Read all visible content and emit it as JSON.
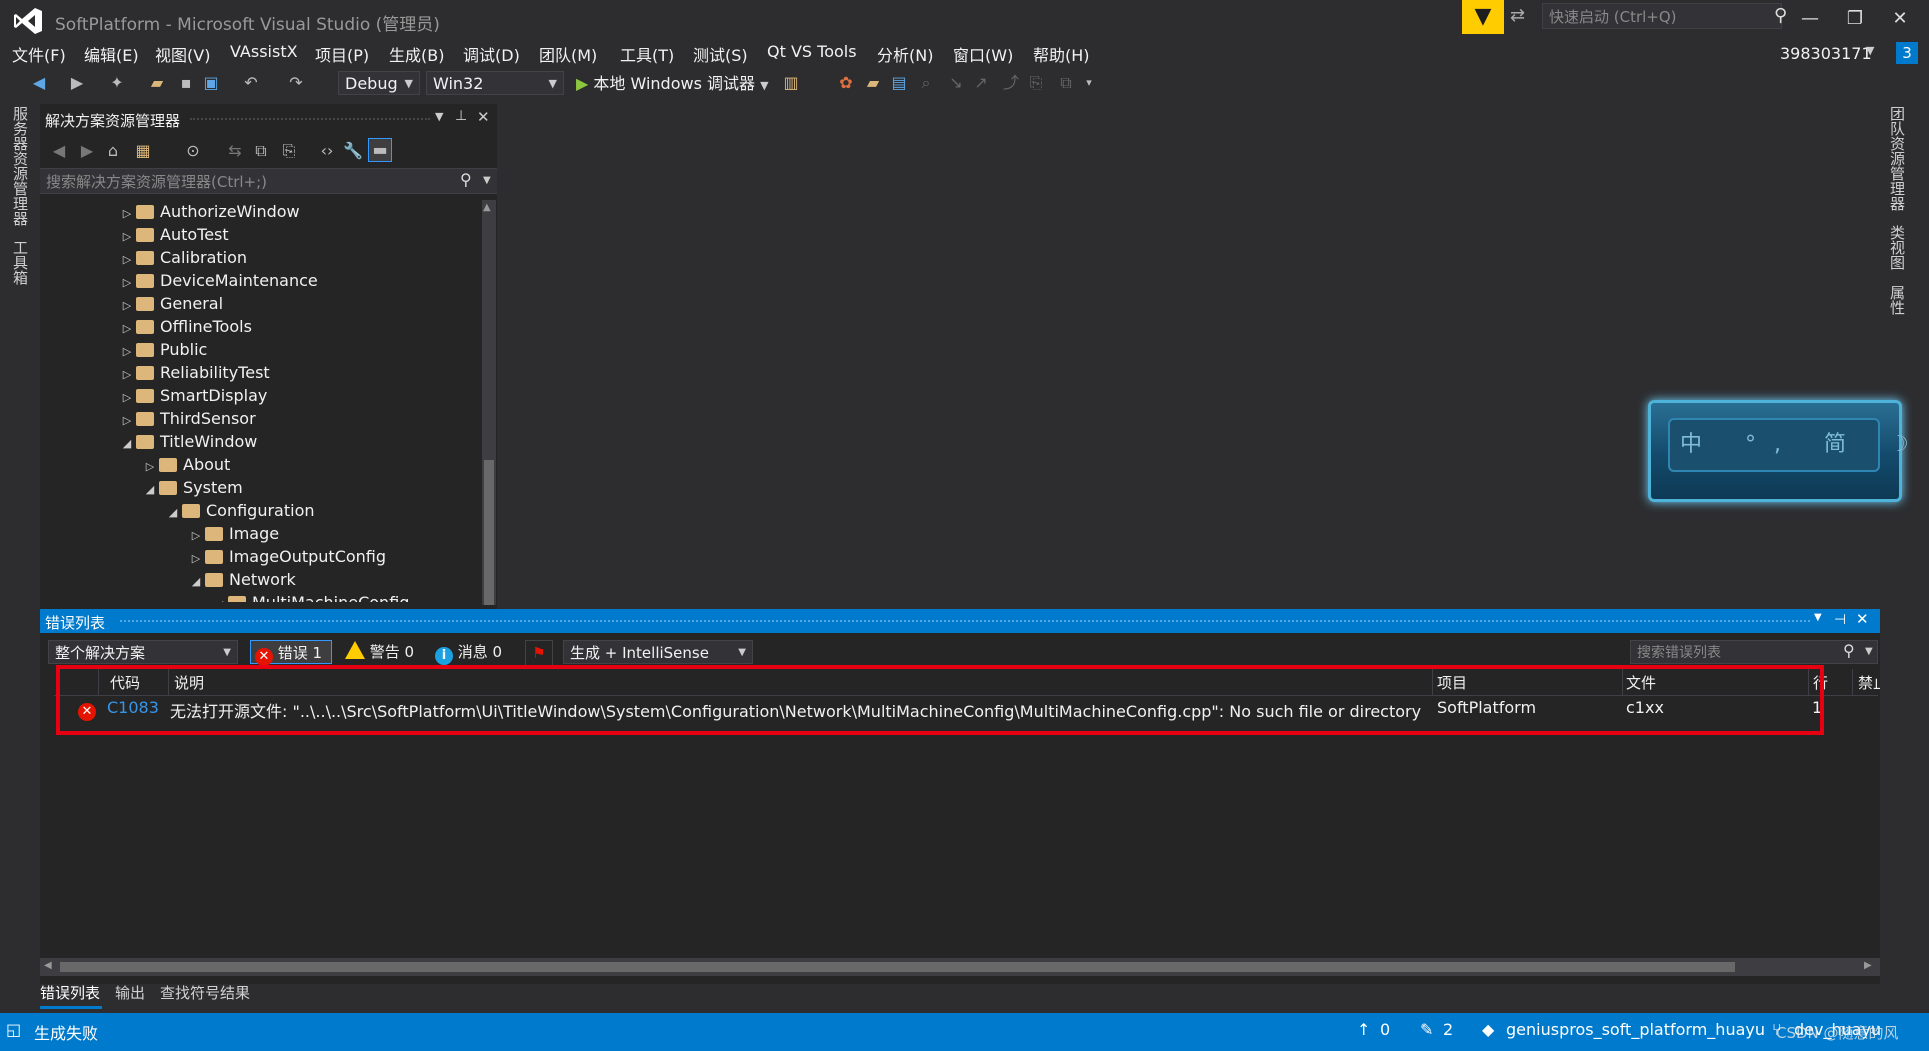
{
  "window": {
    "title": "SoftPlatform - Microsoft Visual Studio (管理员)",
    "quick_launch_placeholder": "快速启动 (Ctrl+Q)",
    "minimize": "—",
    "restore": "❐",
    "close": "✕"
  },
  "menu": [
    "文件(F)",
    "编辑(E)",
    "视图(V)",
    "VAssistX",
    "项目(P)",
    "生成(B)",
    "调试(D)",
    "团队(M)",
    "工具(T)",
    "测试(S)",
    "Qt VS Tools",
    "分析(N)",
    "窗口(W)",
    "帮助(H)"
  ],
  "account": {
    "name": "398303171",
    "notifications": "3"
  },
  "toolbar": {
    "configuration": "Debug",
    "platform": "Win32",
    "run_label": "本地 Windows 调试器"
  },
  "left_tabs": [
    "服务器资源管理器",
    "工具箱"
  ],
  "right_tabs": [
    "团队资源管理器",
    "类视图",
    "属性"
  ],
  "solution_explorer": {
    "title": "解决方案资源管理器",
    "search_placeholder": "搜索解决方案资源管理器(Ctrl+;)",
    "tree": [
      {
        "label": "AuthorizeWindow",
        "level": 0,
        "expanded": false
      },
      {
        "label": "AutoTest",
        "level": 0,
        "expanded": false
      },
      {
        "label": "Calibration",
        "level": 0,
        "expanded": false
      },
      {
        "label": "DeviceMaintenance",
        "level": 0,
        "expanded": false
      },
      {
        "label": "General",
        "level": 0,
        "expanded": false
      },
      {
        "label": "OfflineTools",
        "level": 0,
        "expanded": false
      },
      {
        "label": "Public",
        "level": 0,
        "expanded": false
      },
      {
        "label": "ReliabilityTest",
        "level": 0,
        "expanded": false
      },
      {
        "label": "SmartDisplay",
        "level": 0,
        "expanded": false
      },
      {
        "label": "ThirdSensor",
        "level": 0,
        "expanded": false
      },
      {
        "label": "TitleWindow",
        "level": 0,
        "expanded": true
      },
      {
        "label": "About",
        "level": 1,
        "expanded": false
      },
      {
        "label": "System",
        "level": 1,
        "expanded": true
      },
      {
        "label": "Configuration",
        "level": 2,
        "expanded": true
      },
      {
        "label": "Image",
        "level": 3,
        "expanded": false
      },
      {
        "label": "ImageOutputConfig",
        "level": 3,
        "expanded": false
      },
      {
        "label": "Network",
        "level": 3,
        "expanded": true
      },
      {
        "label": "MultiMachineConfig",
        "level": 4,
        "expanded": true
      }
    ]
  },
  "ime": {
    "text": "中 °, 简 ☽"
  },
  "error_list": {
    "title": "错误列表",
    "scope": "整个解决方案",
    "errors_label": "错误 1",
    "warnings_label": "警告 0",
    "messages_label": "消息 0",
    "source": "生成 + IntelliSense",
    "search_placeholder": "搜索错误列表",
    "columns": [
      "代码",
      "说明",
      "项目",
      "文件",
      "行",
      "禁止显示状态"
    ],
    "rows": [
      {
        "code": "C1083",
        "description": "无法打开源文件: \"..\\..\\..\\Src\\SoftPlatform\\Ui\\TitleWindow\\System\\Configuration\\Network\\MultiMachineConfig\\MultiMachineConfig.cpp\": No such file or directory",
        "project": "SoftPlatform",
        "file": "c1xx",
        "line": "1"
      }
    ]
  },
  "bottom_tabs": [
    "错误列表",
    "输出",
    "查找符号结果"
  ],
  "status": {
    "message": "生成失败",
    "push_count": "0",
    "pending_changes": "2",
    "repo": "geniuspros_soft_platform_huayu",
    "branch": "dev_huayu",
    "watermark": "CSDN @随意的风"
  },
  "colors": {
    "accent": "#007acc",
    "highlight": "#e60012",
    "error": "#e51400",
    "warning": "#ffcc00",
    "folder": "#dcb67a"
  }
}
